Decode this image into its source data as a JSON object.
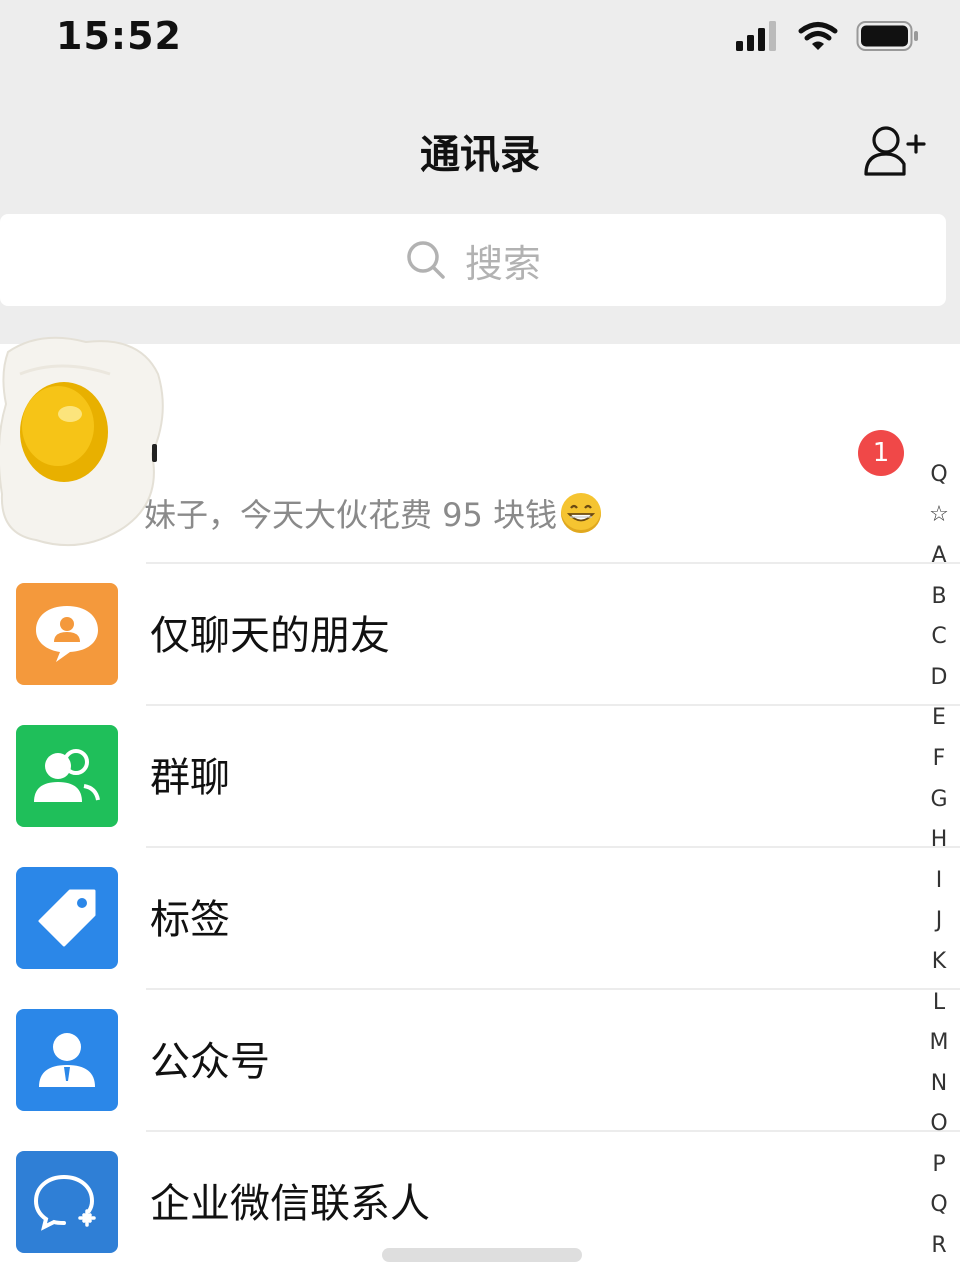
{
  "status_bar": {
    "time": "15:52"
  },
  "nav": {
    "title": "通讯录"
  },
  "search": {
    "placeholder": "搜索"
  },
  "new_friend": {
    "badge": "1",
    "message": "妹子，今天大伙花费 95 块钱"
  },
  "entries": [
    {
      "label": "仅聊天的朋友",
      "color": "#f4993c",
      "icon": "chat-person-icon"
    },
    {
      "label": "群聊",
      "color": "#1fbf5a",
      "icon": "group-icon"
    },
    {
      "label": "标签",
      "color": "#2b87e8",
      "icon": "tag-icon"
    },
    {
      "label": "公众号",
      "color": "#2b87e8",
      "icon": "person-icon"
    },
    {
      "label": "企业微信联系人",
      "color": "#2f7fd6",
      "icon": "wecom-icon"
    }
  ],
  "index": [
    "Q",
    "☆",
    "A",
    "B",
    "C",
    "D",
    "E",
    "F",
    "G",
    "H",
    "I",
    "J",
    "K",
    "L",
    "M",
    "N",
    "O",
    "P",
    "Q",
    "R"
  ]
}
